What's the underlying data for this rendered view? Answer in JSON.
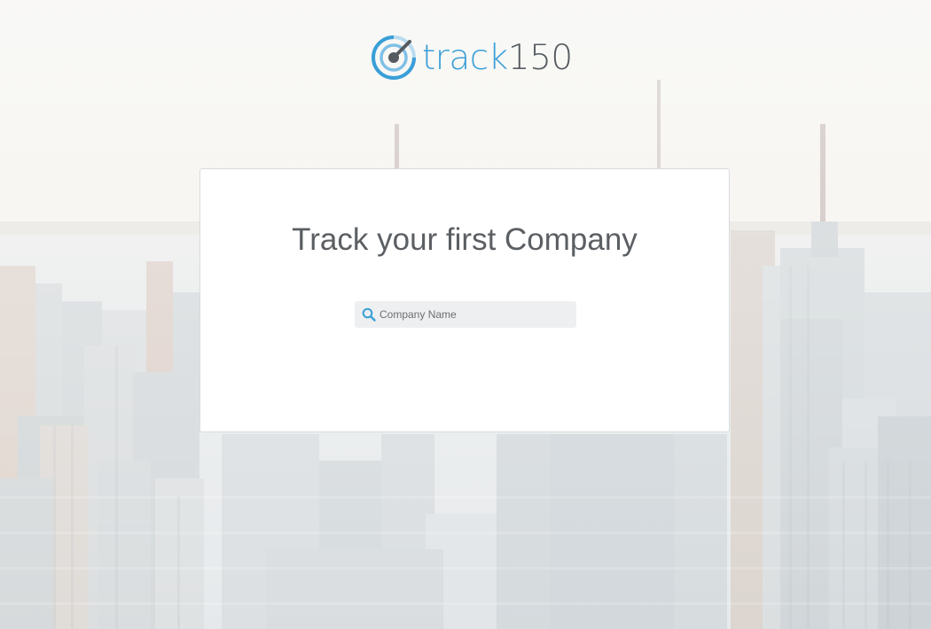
{
  "brand": {
    "name_part1": "track",
    "name_part2": "150",
    "accent_color": "#3a9fd8",
    "dark_color": "#555b60",
    "logo_icon": "radar-gauge-icon"
  },
  "onboarding": {
    "title": "Track your first Company",
    "search": {
      "placeholder": "Company Name",
      "value": "",
      "icon": "search-icon"
    }
  },
  "background": {
    "description_icon": "city-skyline-background"
  }
}
